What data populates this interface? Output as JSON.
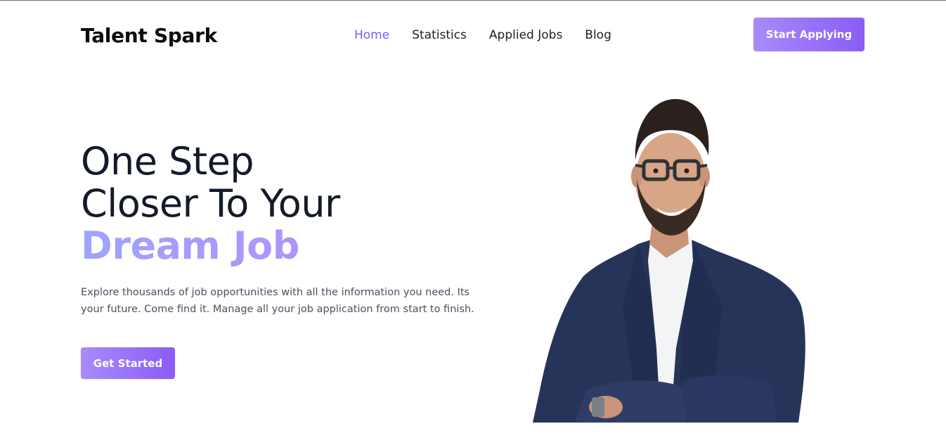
{
  "brand": {
    "name": "Talent Spark"
  },
  "nav": {
    "items": [
      {
        "label": "Home",
        "active": true
      },
      {
        "label": "Statistics",
        "active": false
      },
      {
        "label": "Applied Jobs",
        "active": false
      },
      {
        "label": "Blog",
        "active": false
      }
    ],
    "cta_label": "Start Applying"
  },
  "hero": {
    "headline_line1": "One Step",
    "headline_line2": "Closer To Your",
    "headline_accent": "Dream Job",
    "description": "Explore thousands of job opportunities with all the information you need. Its your future. Come find it. Manage all your job application from start to finish.",
    "cta_label": "Get Started",
    "image_icon": "person-in-suit-portrait"
  },
  "colors": {
    "accent": "#8b5cf6",
    "accent_light": "#a78bfa",
    "nav_active": "#7e5bef",
    "headline": "#131a2b",
    "body_text": "#4b5060"
  }
}
